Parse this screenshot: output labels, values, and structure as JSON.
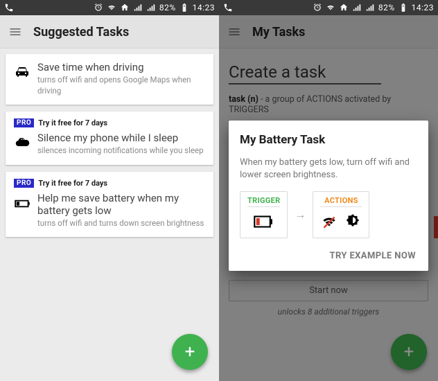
{
  "status": {
    "battery_pct": "82%",
    "time": "14:23"
  },
  "left": {
    "title": "Suggested Tasks",
    "cards": [
      {
        "title": "Save time when driving",
        "sub": "turns off wifi and opens Google Maps when driving",
        "pro": null
      },
      {
        "title": "Silence my phone while I sleep",
        "sub": "silences incoming notifications while you sleep",
        "pro": {
          "badge": "PRO",
          "text": "Try it free for 7 days"
        }
      },
      {
        "title": "Help me save battery when my battery gets low",
        "sub": "turns off wifi and turns down screen brightness",
        "pro": {
          "badge": "PRO",
          "text": "Try it free for 7 days"
        }
      }
    ]
  },
  "right": {
    "title": "My Tasks",
    "bg": {
      "headline": "Create a task",
      "def_word": "task (n)",
      "def_dash": " - ",
      "def_rest": "a group of ACTIONS activated by TRIGGERS",
      "start": "Start now",
      "unlocks": "unlocks 8 additional triggers"
    },
    "dialog": {
      "title": "My Battery Task",
      "desc": "When my battery gets low, turn off wifi and lower screen brightness.",
      "trigger_label": "TRIGGER",
      "actions_label": "ACTIONS",
      "cta": "TRY EXAMPLE NOW"
    }
  }
}
